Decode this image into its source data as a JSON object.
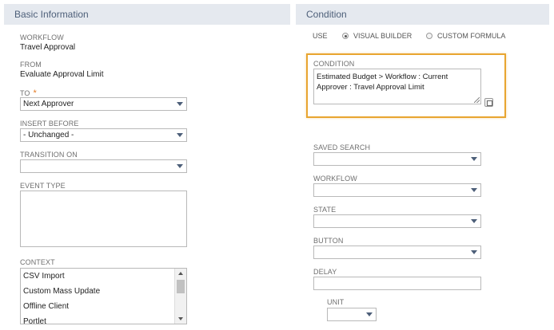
{
  "left_section": {
    "title": "Basic Information",
    "workflow_label": "WORKFLOW",
    "workflow_value": "Travel Approval",
    "from_label": "FROM",
    "from_value": "Evaluate Approval Limit",
    "to_label": "TO",
    "to_required": "*",
    "to_value": "Next Approver",
    "insert_before_label": "INSERT BEFORE",
    "insert_before_value": "- Unchanged -",
    "transition_on_label": "TRANSITION ON",
    "transition_on_value": "",
    "event_type_label": "EVENT TYPE",
    "context_label": "CONTEXT",
    "context_items": [
      "CSV Import",
      "Custom Mass Update",
      "Offline Client",
      "Portlet"
    ]
  },
  "right_section": {
    "title": "Condition",
    "use_label": "USE",
    "visual_builder_label": "VISUAL BUILDER",
    "custom_formula_label": "CUSTOM FORMULA",
    "selected_mode": "VISUAL BUILDER",
    "condition_label": "CONDITION",
    "condition_text": "Estimated Budget > Workflow : Current Approver : Travel Approval Limit",
    "saved_search_label": "SAVED SEARCH",
    "workflow_label": "WORKFLOW",
    "state_label": "STATE",
    "button_label": "BUTTON",
    "delay_label": "DELAY",
    "unit_label": "UNIT"
  },
  "colors": {
    "header_bg": "#e5e9ef",
    "header_text": "#4d5f79",
    "highlight_border": "#e8a530",
    "required": "#e47b25"
  }
}
